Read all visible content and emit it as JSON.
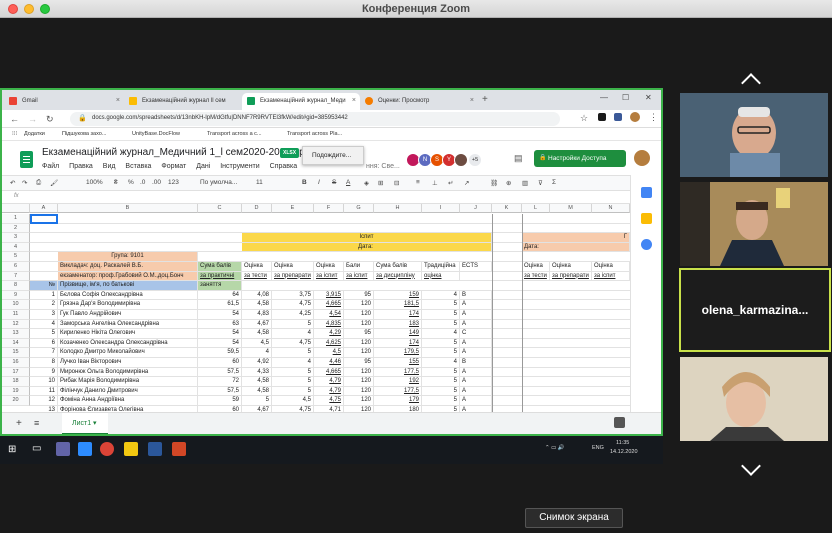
{
  "window": {
    "title": "Конференция Zoom"
  },
  "browser": {
    "tabs": [
      {
        "label": "Gmail"
      },
      {
        "label": "Екзаменаційний журнал ll сем"
      },
      {
        "label": "Екзаменаційний журнал_Меди"
      },
      {
        "label": "Оценки: Просмотр"
      }
    ],
    "new_tab": "+",
    "url": "docs.google.com/spreadsheets/d/13nbKH-lpM/dGtfu|DNNF7R9RVTEl3fkW/edit#gid=385953442",
    "bookmarks": [
      "Додатки",
      "Підшукова захо...",
      "UnityBase.DocFlow",
      "Transport across a c...",
      "Transport across Pla..."
    ]
  },
  "sheet": {
    "title": "Екзаменаційний журнал_Медичний 1_l сем2020-2021н.р.",
    "badge": "XLSX",
    "menu": [
      "Файл",
      "Правка",
      "Вид",
      "Вставка",
      "Формат",
      "Дані",
      "Інструменти",
      "Справка"
    ],
    "hint_suffix": "ння: Све...",
    "waiting": "Подождите...",
    "access_button": "Настройки Доступа",
    "avatar_letters": [
      "N",
      "S",
      "Y"
    ],
    "avatar_more": "+5",
    "toolbar": {
      "zoom": "100%",
      "currency": "₴",
      "percent": "%",
      "dec0": ".0",
      "dec00": ".00",
      "fmt": "123",
      "font": "По умолча...",
      "size": "11",
      "bold": "B",
      "italic": "I",
      "strike": "S",
      "text_color": "A"
    },
    "formula_fx": "fx",
    "columns": [
      "A",
      "B",
      "C",
      "D",
      "E",
      "F",
      "G",
      "H",
      "I",
      "J",
      "K",
      "L",
      "M",
      "N"
    ],
    "row_numbers": [
      "1",
      "2",
      "3",
      "4",
      "5",
      "6",
      "7",
      "8",
      "9",
      "10",
      "11",
      "12",
      "13",
      "14",
      "15",
      "16",
      "17",
      "18",
      "19",
      "20"
    ],
    "header_cells": {
      "ispyt": "Іспит",
      "date": "Дата:",
      "date2": "Дата:",
      "group": "Група: 9101",
      "teacher": "Викладач: доц. Раскалей В.Б.",
      "examiner": "екзаменатор: проф.Грабовий О.М.,доц.Бонч",
      "sum_practical_1": "Сума балів",
      "sum_practical_2": "за практичні",
      "sum_practical_3": "заняття",
      "no": "№",
      "pib": "Прізвище, ім'я, по батькові",
      "d1": "Оцінка",
      "d2": "за тести",
      "e1": "Оцінка",
      "e2": "за препарати",
      "f1": "Оцінка",
      "f2": "за іспит",
      "g1": "Бали",
      "g2": "за іспит",
      "h1": "Сума балів",
      "h2": "за дисципліну",
      "i1": "Традиційна",
      "i2": "оцінка",
      "j1": "ECTS",
      "l1": "Оцінка",
      "l2": "за тести",
      "m1": "Оцінка",
      "m2": "за препарати",
      "n1": "Оцінка",
      "n2": "за іспит",
      "o_cut": "Г",
      "o_cut2": "Б",
      "o_cut3": "з"
    },
    "students": [
      {
        "n": "1",
        "name": "Бєлова Софія Олександрівна",
        "c": "64",
        "d": "4,08",
        "e": "3,75",
        "f": "3,915",
        "g": "95",
        "h": "159",
        "i": "4",
        "j": "B"
      },
      {
        "n": "2",
        "name": "Грязна Дар'я Володимирівна",
        "c": "61,5",
        "d": "4,58",
        "e": "4,75",
        "f": "4,665",
        "g": "120",
        "h": "181,5",
        "i": "5",
        "j": "A"
      },
      {
        "n": "3",
        "name": "Гук Павло Андрійович",
        "c": "54",
        "d": "4,83",
        "e": "4,25",
        "f": "4,54",
        "g": "120",
        "h": "174",
        "i": "5",
        "j": "A"
      },
      {
        "n": "4",
        "name": "Заморська Ангеліна Олександрівна",
        "c": "63",
        "d": "4,67",
        "e": "5",
        "f": "4,835",
        "g": "120",
        "h": "183",
        "i": "5",
        "j": "A"
      },
      {
        "n": "5",
        "name": "Кириленко Нікіта Олегович",
        "c": "54",
        "d": "4,58",
        "e": "4",
        "f": "4,29",
        "g": "95",
        "h": "149",
        "i": "4",
        "j": "C"
      },
      {
        "n": "6",
        "name": "Козаченко Олександра Олександрівна",
        "c": "54",
        "d": "4,5",
        "e": "4,75",
        "f": "4,625",
        "g": "120",
        "h": "174",
        "i": "5",
        "j": "A"
      },
      {
        "n": "7",
        "name": "Колодко Дмитро Миколайович",
        "c": "59,5",
        "d": "4",
        "e": "5",
        "f": "4,5",
        "g": "120",
        "h": "179,5",
        "i": "5",
        "j": "A"
      },
      {
        "n": "8",
        "name": "Лучко Іван Вікторович",
        "c": "60",
        "d": "4,92",
        "e": "4",
        "f": "4,46",
        "g": "95",
        "h": "155",
        "i": "4",
        "j": "B"
      },
      {
        "n": "9",
        "name": "Миронюк Ольга Володимирівна",
        "c": "57,5",
        "d": "4,33",
        "e": "5",
        "f": "4,665",
        "g": "120",
        "h": "177,5",
        "i": "5",
        "j": "A"
      },
      {
        "n": "10",
        "name": "Рибак Марія Володимирівна",
        "c": "72",
        "d": "4,58",
        "e": "5",
        "f": "4,79",
        "g": "120",
        "h": "192",
        "i": "5",
        "j": "A"
      },
      {
        "n": "11",
        "name": "Філінчук Данило Дмитрович",
        "c": "57,5",
        "d": "4,58",
        "e": "5",
        "f": "4,79",
        "g": "120",
        "h": "177,5",
        "i": "5",
        "j": "A"
      },
      {
        "n": "12",
        "name": "Фоміна Анна Андріївна",
        "c": "59",
        "d": "5",
        "e": "4,5",
        "f": "4,75",
        "g": "120",
        "h": "179",
        "i": "5",
        "j": "A"
      },
      {
        "n": "13",
        "name": "Форінова Єлизавета Олегівна",
        "c": "60",
        "d": "4,67",
        "e": "4,75",
        "f": "4,71",
        "g": "120",
        "h": "180",
        "i": "5",
        "j": "A"
      }
    ],
    "sheet_tab": "Лист1",
    "add_sheet": "+",
    "sheet_list": "≡"
  },
  "taskbar": {
    "lang": "ENG",
    "time": "11:35",
    "date": "14.12.2020"
  },
  "zoom": {
    "participant_name": "olena_karmazina...",
    "screenshot_button": "Снимок экрана"
  },
  "colors": {
    "accent_green": "#3cb34a",
    "sheets_green": "#0f9d58",
    "header_yellow": "#fbd84a",
    "salmon": "#f7cbac",
    "speaker_border": "#c9e14a"
  }
}
